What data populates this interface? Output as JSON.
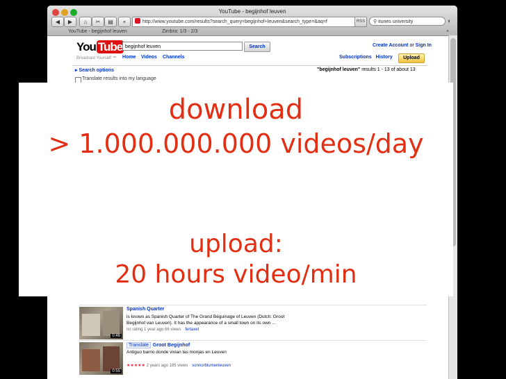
{
  "browser": {
    "window_title": "YouTube - begijnhof leuven",
    "url": "http://www.youtube.com/results?search_query=begijnhof+leuven&search_type=&aq=f",
    "search_box": "itunes university",
    "tabs": [
      {
        "label": "YouTube - begijnhof leuven"
      },
      {
        "label": "Zimbra: 1/3 - 2/3"
      }
    ]
  },
  "youtube": {
    "logo_text": "You",
    "logo_tube": "Tube",
    "slogan": "Broadcast Yourself ™",
    "search_value": "begijnhof leuven",
    "search_button": "Search",
    "nav": [
      "Home",
      "Videos",
      "Channels"
    ],
    "create_account": "Create Account",
    "or": "or",
    "sign_in": "Sign In",
    "subscriptions": "Subscriptions",
    "history": "History",
    "upload": "Upload",
    "search_options": "Search options",
    "results_query": "\"begijnhof leuven\"",
    "results_text": "results 1 - 13 of about 13",
    "translate_results": "Translate results into my language"
  },
  "videos": [
    {
      "title": "Spanish Quarter",
      "description": "is known as Spanish Quarter of The Grand Béguinage of Leuven (Dutch: Groot Begijnhof van Leuven). It has the appearance of a small town on its own ...",
      "meta": "no rating   1 year ago   66 views",
      "user": "fertaxel",
      "duration": "0:46",
      "translate_tag": ""
    },
    {
      "title": "Groot Begijnhof",
      "description": "Antiguo barrio donde vivian las monjas en Leuven",
      "meta": "2 years ago   185 views",
      "stars": "★★★★★",
      "user": "sonnorblumenleuven",
      "duration": "0:55",
      "translate_tag": "Translate"
    }
  ],
  "overlay": {
    "line1": "download",
    "line2": "> 1.000.000.000 videos/day",
    "line3": "upload:",
    "line4": "20 hours video/min"
  }
}
